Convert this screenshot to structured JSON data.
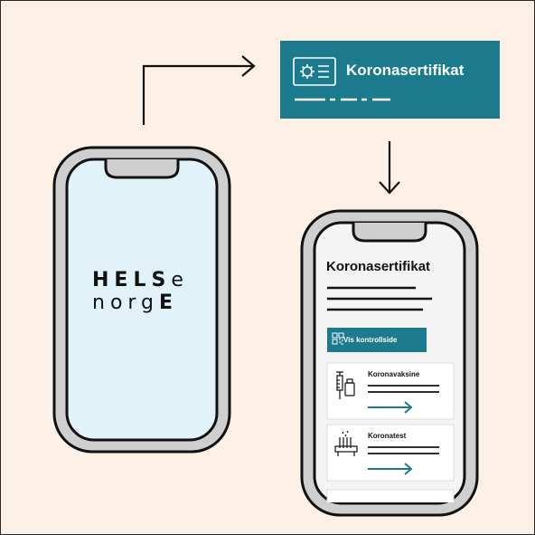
{
  "logo": {
    "line1_bold": "HELS",
    "line1_light": "e",
    "line2_light": "norg",
    "line2_bold": "E"
  },
  "banner": {
    "title": "Koronasertifikat"
  },
  "screen": {
    "title": "Koronasertifikat",
    "button_label": "Vis kontrollside",
    "cards": [
      {
        "label": "Koronavaksine",
        "icon": "vaccine-icon"
      },
      {
        "label": "Koronatest",
        "icon": "test-tubes-icon"
      }
    ]
  },
  "colors": {
    "background": "#fdf1e7",
    "accent": "#1b7a8c",
    "phone_screen": "#e1f3f9",
    "phone_body": "#cfcfcf",
    "outline": "#111111"
  }
}
